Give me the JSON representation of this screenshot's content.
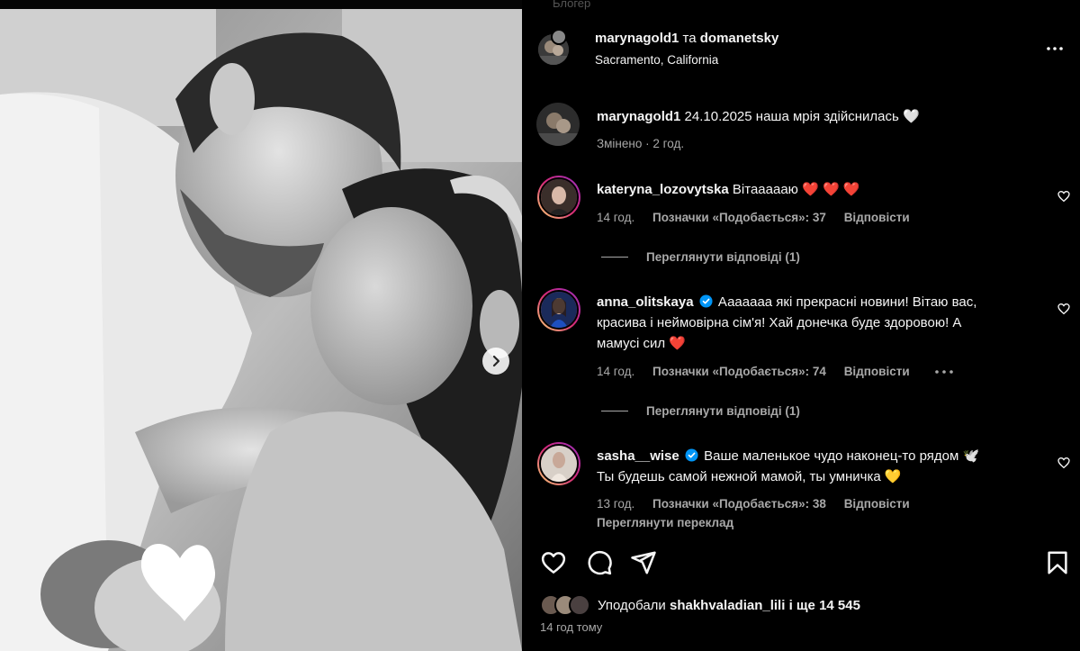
{
  "background_hint": "Блогер",
  "post": {
    "author1": "marynagold1",
    "conjunction": "та",
    "author2": "domanetsky",
    "location": "Sacramento, California",
    "more_icon": "more-horizontal-icon"
  },
  "caption": {
    "user": "marynagold1",
    "text": "24.10.2025 наша мрія здійснилась",
    "emoji": "🤍",
    "meta": "Змінено · 2 год."
  },
  "comments": [
    {
      "user": "kateryna_lozovytska",
      "verified": false,
      "text": "Вітаааааю",
      "hearts": "❤️ ❤️ ❤️",
      "time": "14 год.",
      "likes_label": "Позначки «Подобається»: 37",
      "reply_label": "Відповісти",
      "view_replies": "Переглянути відповіді (1)"
    },
    {
      "user": "anna_olitskaya",
      "verified": true,
      "text_line1": "Ааааааа які прекрасні новини! Вітаю вас,",
      "text_line2": "красива і неймовірна сім'я! Хай донечка буде здоровою! А",
      "text_line3": "мамусі сил",
      "heart": "❤️",
      "time": "14 год.",
      "likes_label": "Позначки «Подобається»: 74",
      "reply_label": "Відповісти",
      "view_replies": "Переглянути відповіді (1)"
    },
    {
      "user": "sasha__wise",
      "verified": true,
      "text_line1": "Ваше маленькое чудо наконец-то рядом",
      "dove": "🕊️",
      "text_line2": "Ты будешь самой нежной мамой, ты умничка",
      "heart": "💛",
      "time": "13 год.",
      "likes_label": "Позначки «Подобається»: 38",
      "reply_label": "Відповісти",
      "translate": "Переглянути переклад"
    }
  ],
  "actions": {
    "like_icon": "heart-icon",
    "comment_icon": "comment-icon",
    "share_icon": "share-icon",
    "save_icon": "bookmark-icon"
  },
  "likes": {
    "prefix": "Уподобали",
    "user": "shakhvaladian_lili",
    "suffix": "і ще 14 545"
  },
  "posted_time": "14 год тому",
  "colors": {
    "background": "#000000",
    "text": "#f5f5f5",
    "secondary": "#a8a8a8",
    "verified": "#0095f6",
    "heart_red": "#e0245e"
  }
}
